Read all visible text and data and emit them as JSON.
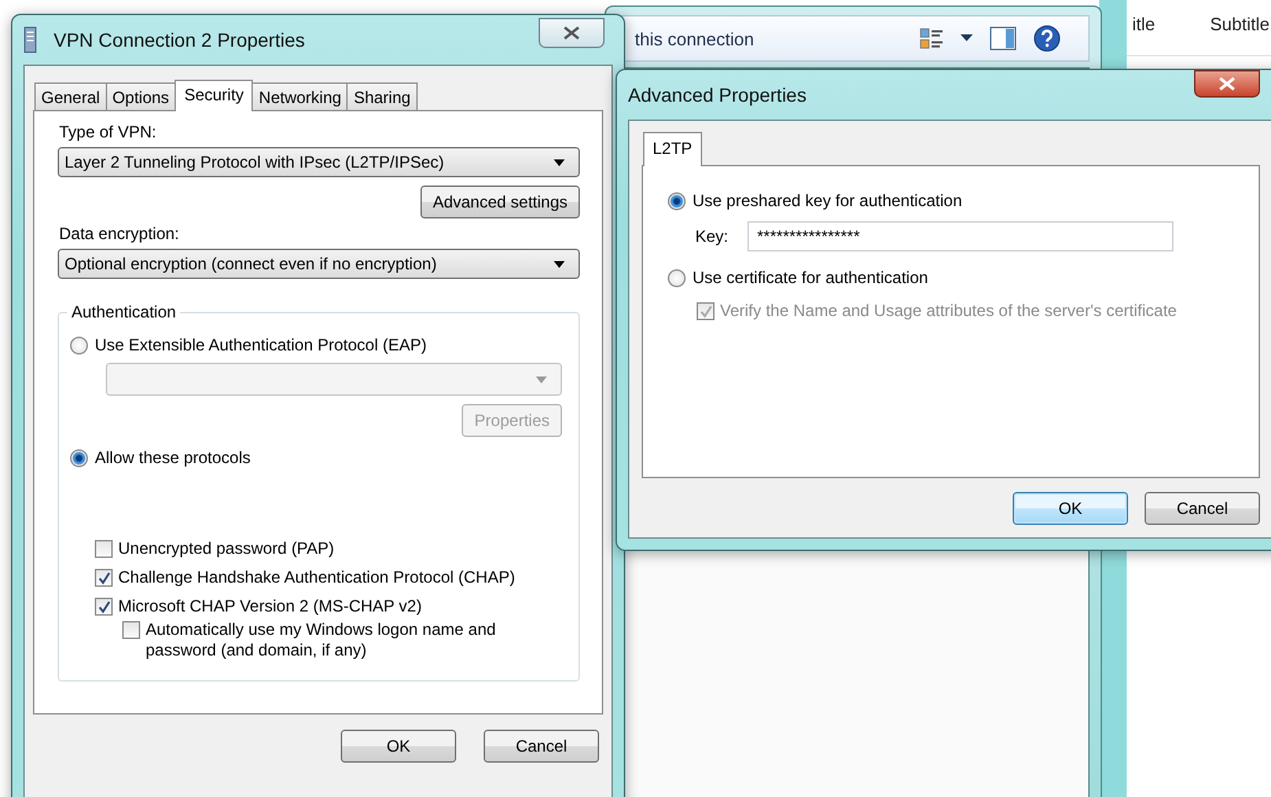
{
  "background_window": {
    "toolbar_text": "this connection",
    "column_headers": [
      "itle",
      "Subtitle"
    ]
  },
  "vpn_dialog": {
    "title": "VPN Connection 2 Properties",
    "tabs": [
      {
        "label": "General",
        "selected": false
      },
      {
        "label": "Options",
        "selected": false
      },
      {
        "label": "Security",
        "selected": true
      },
      {
        "label": "Networking",
        "selected": false
      },
      {
        "label": "Sharing",
        "selected": false
      }
    ],
    "type_of_vpn": {
      "label": "Type of VPN:",
      "value": "Layer 2 Tunneling Protocol with IPsec (L2TP/IPSec)"
    },
    "advanced_button": "Advanced settings",
    "data_encryption": {
      "label": "Data encryption:",
      "value": "Optional encryption (connect even if no encryption)"
    },
    "authentication": {
      "title": "Authentication",
      "eap": {
        "label": "Use Extensible Authentication Protocol (EAP)",
        "selected": false,
        "dropdown_disabled": true,
        "properties_button": "Properties",
        "properties_disabled": true
      },
      "allow": {
        "label": "Allow these protocols",
        "selected": true
      },
      "protocols": [
        {
          "label": "Unencrypted password (PAP)",
          "checked": false
        },
        {
          "label": "Challenge Handshake Authentication Protocol (CHAP)",
          "checked": true
        },
        {
          "label": "Microsoft CHAP Version 2 (MS-CHAP v2)",
          "checked": true,
          "children": [
            {
              "label": "Automatically use my Windows logon name and password (and domain, if any)",
              "checked": false
            }
          ]
        }
      ]
    },
    "buttons": [
      {
        "label": "OK",
        "default": false
      },
      {
        "label": "Cancel",
        "default": false
      }
    ]
  },
  "advanced_dialog": {
    "title": "Advanced Properties",
    "tabs": [
      {
        "label": "L2TP",
        "selected": true
      }
    ],
    "preshared": {
      "label": "Use preshared key for authentication",
      "selected": true,
      "key_label": "Key:",
      "key_value": "****************"
    },
    "certificate": {
      "label": "Use certificate for authentication",
      "selected": false,
      "verify": {
        "label": "Verify the Name and Usage attributes of the server's certificate",
        "checked": true,
        "disabled": true
      }
    },
    "buttons": [
      {
        "label": "OK",
        "default": true
      },
      {
        "label": "Cancel",
        "default": false
      }
    ]
  }
}
